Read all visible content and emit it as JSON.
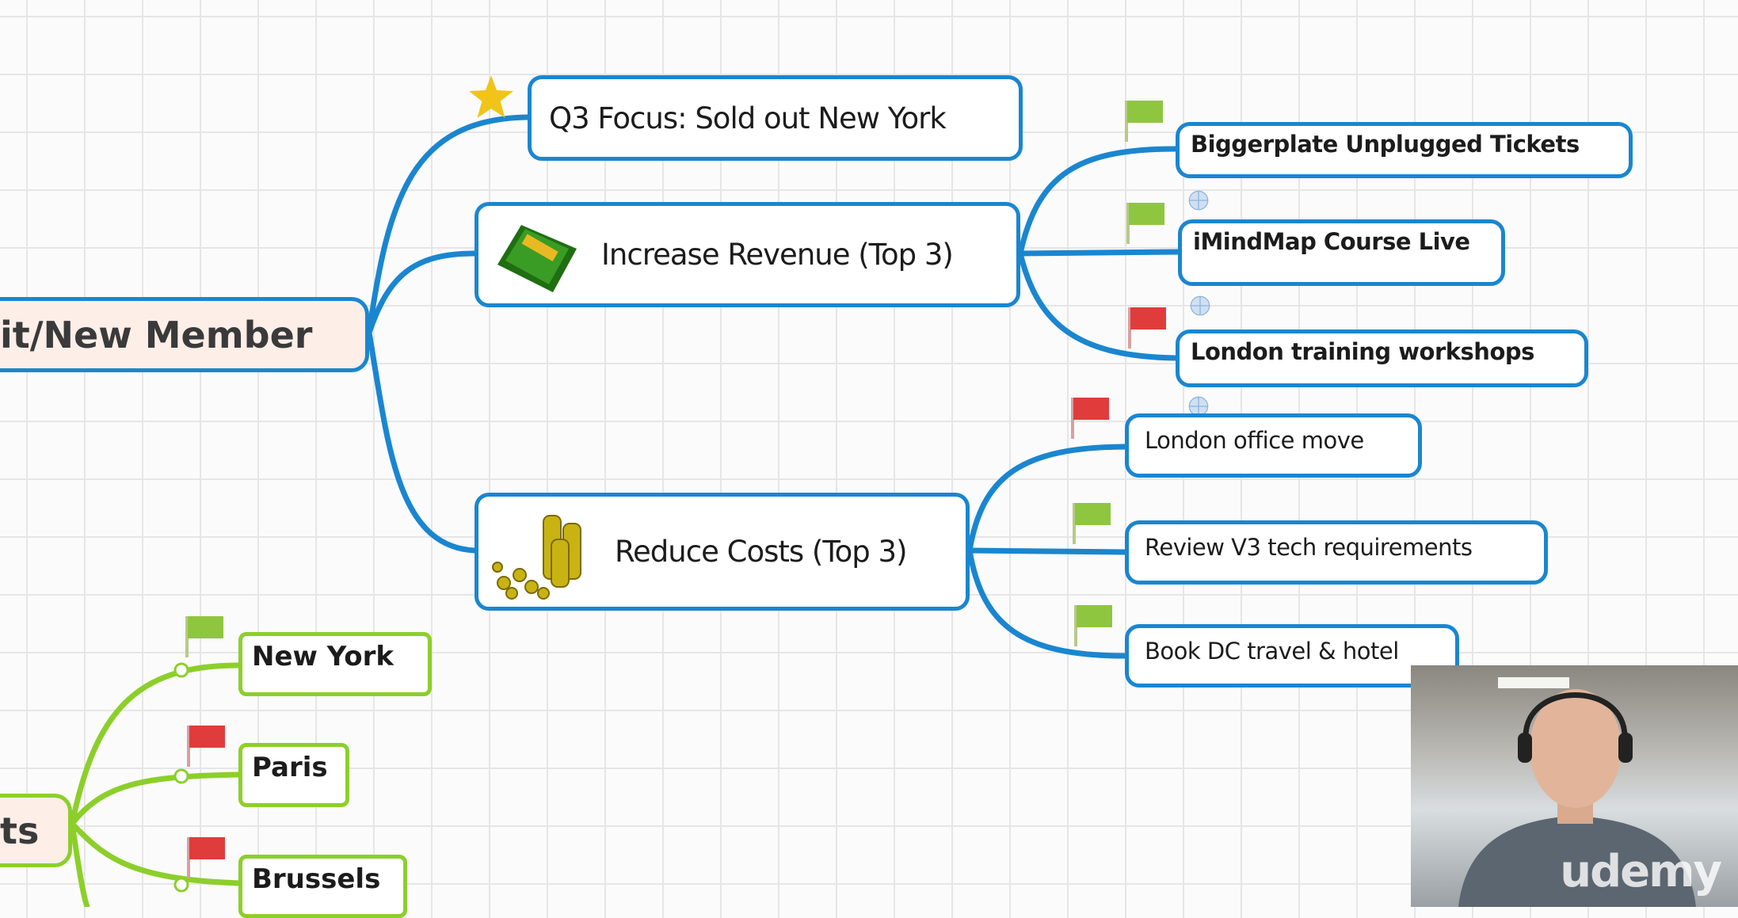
{
  "mindmap": {
    "root": {
      "label": "it/New Member"
    },
    "root2": {
      "label": "ts"
    },
    "branches": [
      {
        "label": "Q3 Focus: Sold out New York",
        "icon": "star-icon"
      },
      {
        "label": "Increase Revenue (Top 3)",
        "icon": "money-stack-icon",
        "children": [
          {
            "label": "Biggerplate Unplugged Tickets",
            "flag": "green"
          },
          {
            "label": "iMindMap Course Live",
            "flag": "green"
          },
          {
            "label": "London training workshops",
            "flag": "red"
          }
        ]
      },
      {
        "label": "Reduce Costs (Top 3)",
        "icon": "gold-coins-icon",
        "children": [
          {
            "label": "London office move",
            "flag": "red"
          },
          {
            "label": "Review V3 tech requirements",
            "flag": "green"
          },
          {
            "label": "Book DC travel & hotel",
            "flag": "green"
          }
        ]
      }
    ],
    "cities": [
      {
        "label": "New York",
        "flag": "green"
      },
      {
        "label": "Paris",
        "flag": "red"
      },
      {
        "label": "Brussels",
        "flag": "red"
      }
    ]
  },
  "colors": {
    "blue_branch": "#1a86d0",
    "green_branch": "#8ccf2a",
    "flag_green": "#8fc63f",
    "flag_red": "#e03c3c",
    "star": "#f0c419"
  },
  "webcam": {
    "watermark": "udemy"
  }
}
